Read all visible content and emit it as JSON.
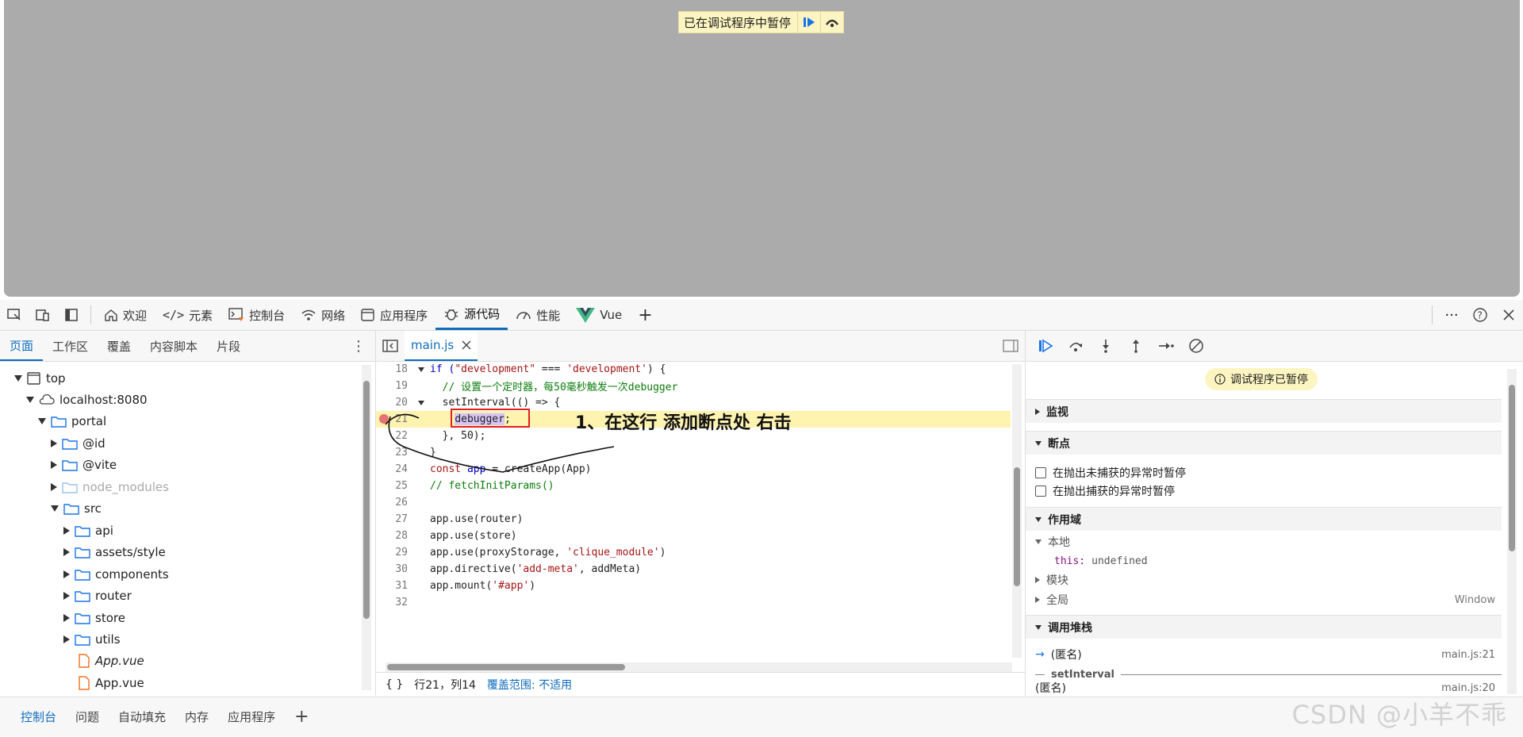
{
  "paused_banner": {
    "text": "已在调试程序中暂停"
  },
  "toolbar": {
    "tabs": [
      {
        "label": "欢迎",
        "icon": "home-icon"
      },
      {
        "label": "元素",
        "icon": "code-icon"
      },
      {
        "label": "控制台",
        "icon": "console-icon"
      },
      {
        "label": "网络",
        "icon": "wifi-icon"
      },
      {
        "label": "应用程序",
        "icon": "app-icon"
      },
      {
        "label": "源代码",
        "icon": "bug-icon"
      },
      {
        "label": "性能",
        "icon": "gauge-icon"
      },
      {
        "label": "Vue",
        "icon": "vue-icon"
      }
    ],
    "add": "+"
  },
  "navigator": {
    "tabs": [
      "页面",
      "工作区",
      "覆盖",
      "内容脚本",
      "片段"
    ],
    "tree": [
      {
        "label": "top"
      },
      {
        "label": "localhost:8080"
      },
      {
        "label": "portal"
      },
      {
        "label": "@id"
      },
      {
        "label": "@vite"
      },
      {
        "label": "node_modules"
      },
      {
        "label": "src"
      },
      {
        "label": "api"
      },
      {
        "label": "assets/style"
      },
      {
        "label": "components"
      },
      {
        "label": "router"
      },
      {
        "label": "store"
      },
      {
        "label": "utils"
      },
      {
        "label": "App.vue"
      },
      {
        "label": "App.vue"
      }
    ]
  },
  "editor": {
    "file_tab": "main.js",
    "lines": [
      {
        "n": "18"
      },
      {
        "n": "19"
      },
      {
        "n": "20"
      },
      {
        "n": "21"
      },
      {
        "n": "22"
      },
      {
        "n": "23"
      },
      {
        "n": "24"
      },
      {
        "n": "25"
      },
      {
        "n": "26"
      },
      {
        "n": "27"
      },
      {
        "n": "28"
      },
      {
        "n": "29"
      },
      {
        "n": "30"
      },
      {
        "n": "31"
      },
      {
        "n": "32"
      }
    ],
    "code": {
      "l18a": "if (",
      "l18b": "\"development\"",
      "l18c": " === ",
      "l18d": "'development'",
      "l18e": ") {",
      "l19": "  // 设置一个定时器，每50毫秒触发一次debugger",
      "l20": "  setInterval(() => {",
      "l21a": "    ",
      "l21b": "debugger",
      "l21c": ";",
      "l22": "  }, 50);",
      "l23": "}",
      "l24a": "const ",
      "l24b": "app",
      "l24c": " = createApp(App)",
      "l25": "// fetchInitParams()",
      "l27": "app.use(router)",
      "l28": "app.use(store)",
      "l29a": "app.use(proxyStorage, ",
      "l29b": "'clique_module'",
      "l29c": ")",
      "l30a": "app.directive(",
      "l30b": "'add-meta'",
      "l30c": ", addMeta)",
      "l31a": "app.mount(",
      "l31b": "'#app'",
      "l31c": ")"
    },
    "annotation": "1、在这行 添加断点处 右击",
    "status": {
      "braces": "{ }",
      "position": "行21，列14",
      "coverage": "覆盖范围: 不适用"
    }
  },
  "debugger": {
    "paused_badge": "调试程序已暂停",
    "sections": {
      "watch": "监视",
      "breakpoints": "断点",
      "scope": "作用域",
      "callstack": "调用堆栈"
    },
    "bp_options": [
      "在抛出未捕获的异常时暂停",
      "在抛出捕获的异常时暂停"
    ],
    "scope": {
      "local": "本地",
      "this_key": "this:",
      "this_val": "undefined",
      "module": "模块",
      "global": "全局",
      "global_val": "Window"
    },
    "callstack": {
      "frame1": "(匿名)",
      "frame1_loc": "main.js:21",
      "async_label": "setInterval",
      "frame2": "(匿名)",
      "frame2_loc": "main.js:20"
    }
  },
  "drawer": {
    "tabs": [
      "控制台",
      "问题",
      "自动填充",
      "内存",
      "应用程序"
    ],
    "add": "+"
  },
  "watermark": "CSDN @小羊不乖",
  "colors": {
    "accent": "#0f6cbd",
    "highlight": "#fff3b0",
    "banner": "#fdf5c1",
    "red_box": "#e02020"
  }
}
